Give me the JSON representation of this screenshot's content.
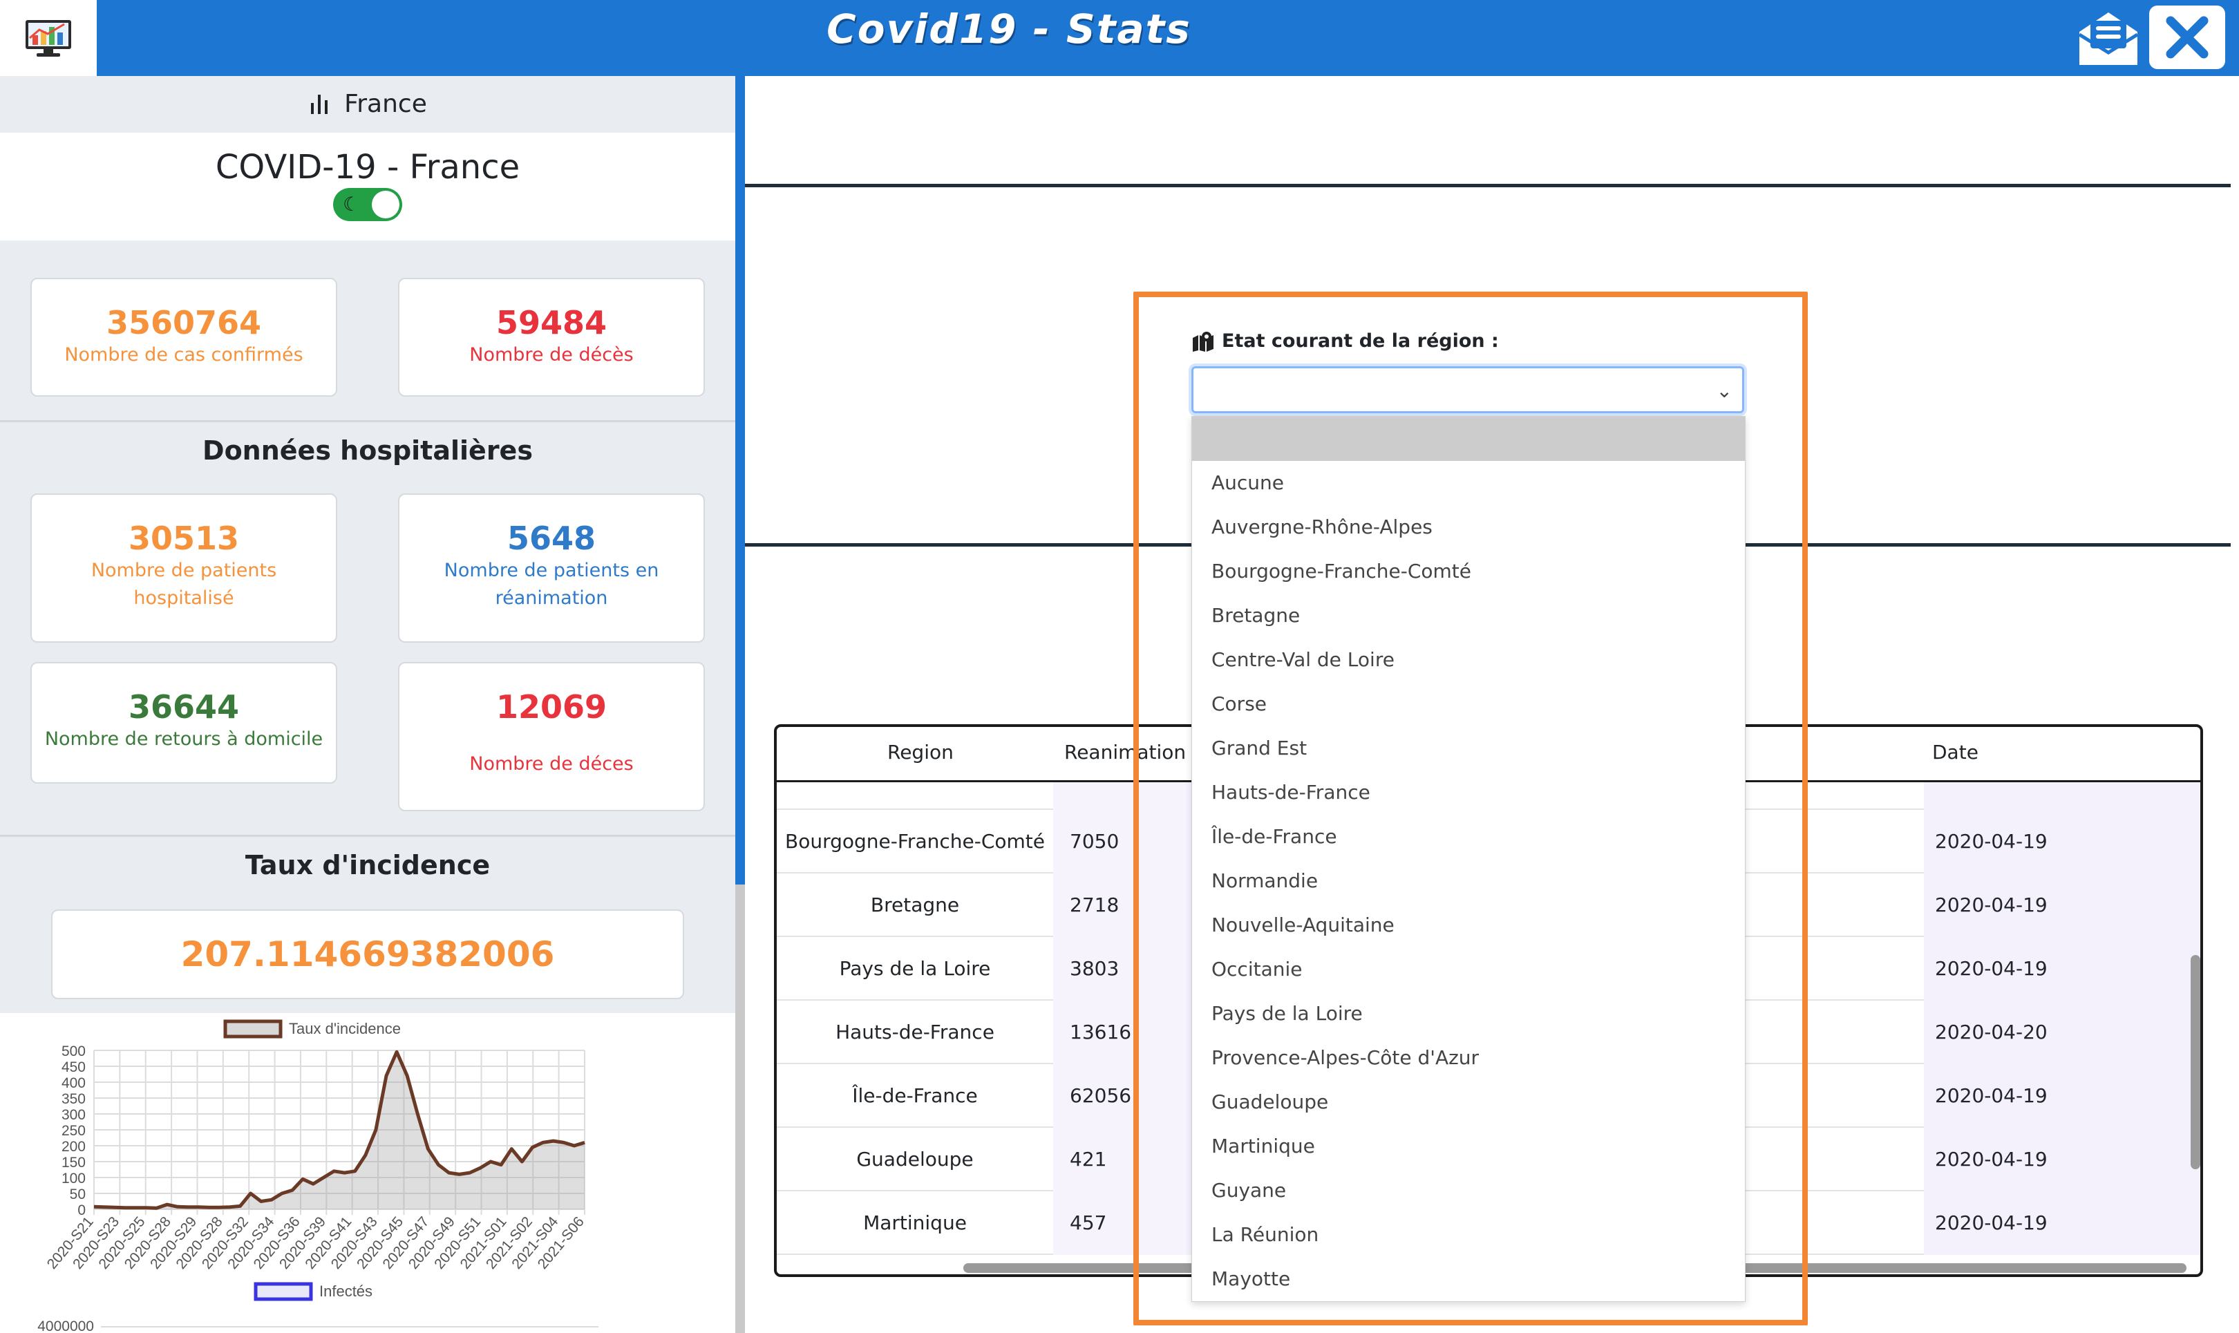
{
  "app": {
    "title": "Covid19 - Stats"
  },
  "left": {
    "header_label": "France",
    "country_title": "COVID-19 - France",
    "summary": [
      {
        "value": "3560764",
        "label": "Nombre de cas confirmés",
        "color": "#f5923b"
      },
      {
        "value": "59484",
        "label": "Nombre de décès",
        "color": "#e8323c"
      }
    ],
    "hospital_title": "Données hospitalières",
    "hospital": [
      {
        "value": "30513",
        "label": "Nombre de patients hospitalisé",
        "color": "#f5923b"
      },
      {
        "value": "5648",
        "label": "Nombre de patients en réanimation",
        "color": "#2f7ac9"
      },
      {
        "value": "36644",
        "label": "Nombre de retours à domicile",
        "color": "#3a7a3a"
      },
      {
        "value": "12069",
        "label": "Nombre de déces",
        "color": "#e8323c"
      }
    ],
    "incidence_title": "Taux d'incidence",
    "incidence_value": "207.114669382006"
  },
  "chart_data": [
    {
      "type": "area",
      "series": [
        {
          "name": "Taux d'incidence",
          "color": "#6b3a26"
        }
      ],
      "x_tick_labels": [
        "2020-S21",
        "2020-S23",
        "2020-S25",
        "2020-S28",
        "2020-S29",
        "2020-S28",
        "2020-S32",
        "2020-S34",
        "2020-S36",
        "2020-S39",
        "2020-S41",
        "2020-S43",
        "2020-S45",
        "2020-S47",
        "2020-S49",
        "2020-S51",
        "2021-S01",
        "2021-S02",
        "2021-S04",
        "2021-S06"
      ],
      "y_ticks": [
        0,
        50,
        100,
        150,
        200,
        250,
        300,
        350,
        400,
        450,
        500
      ],
      "ylim": [
        0,
        500
      ],
      "values": [
        8,
        7,
        6,
        5,
        5,
        5,
        4,
        15,
        8,
        7,
        7,
        6,
        6,
        7,
        10,
        50,
        25,
        30,
        50,
        60,
        95,
        80,
        100,
        120,
        115,
        120,
        170,
        250,
        420,
        495,
        420,
        300,
        190,
        140,
        115,
        110,
        115,
        130,
        150,
        140,
        190,
        150,
        195,
        210,
        215,
        210,
        200,
        210
      ]
    },
    {
      "type": "line",
      "series": [
        {
          "name": "Infectés",
          "color": "#3a33e0"
        }
      ],
      "y_ticks": [
        4000000
      ]
    }
  ],
  "right": {
    "region_label": "Etat courant de la région :",
    "region_options": [
      "Aucune",
      "Auvergne-Rhône-Alpes",
      "Bourgogne-Franche-Comté",
      "Bretagne",
      "Centre-Val de Loire",
      "Corse",
      "Grand Est",
      "Hauts-de-France",
      "Île-de-France",
      "Normandie",
      "Nouvelle-Aquitaine",
      "Occitanie",
      "Pays de la Loire",
      "Provence-Alpes-Côte d'Azur",
      "Guadeloupe",
      "Martinique",
      "Guyane",
      "La Réunion",
      "Mayotte"
    ],
    "table": {
      "headers": {
        "region": "Region",
        "rea": "Reanimation",
        "date": "Date"
      },
      "rows": [
        {
          "region": "Bourgogne-Franche-Comté",
          "rea": "7050",
          "date": "2020-04-19"
        },
        {
          "region": "Bretagne",
          "rea": "2718",
          "date": "2020-04-19"
        },
        {
          "region": "Pays de la Loire",
          "rea": "3803",
          "date": "2020-04-19"
        },
        {
          "region": "Hauts-de-France",
          "rea": "13616",
          "date": "2020-04-20"
        },
        {
          "region": "Île-de-France",
          "rea": "62056",
          "date": "2020-04-19"
        },
        {
          "region": "Guadeloupe",
          "rea": "421",
          "date": "2020-04-19"
        },
        {
          "region": "Martinique",
          "rea": "457",
          "date": "2020-04-19"
        }
      ]
    }
  }
}
